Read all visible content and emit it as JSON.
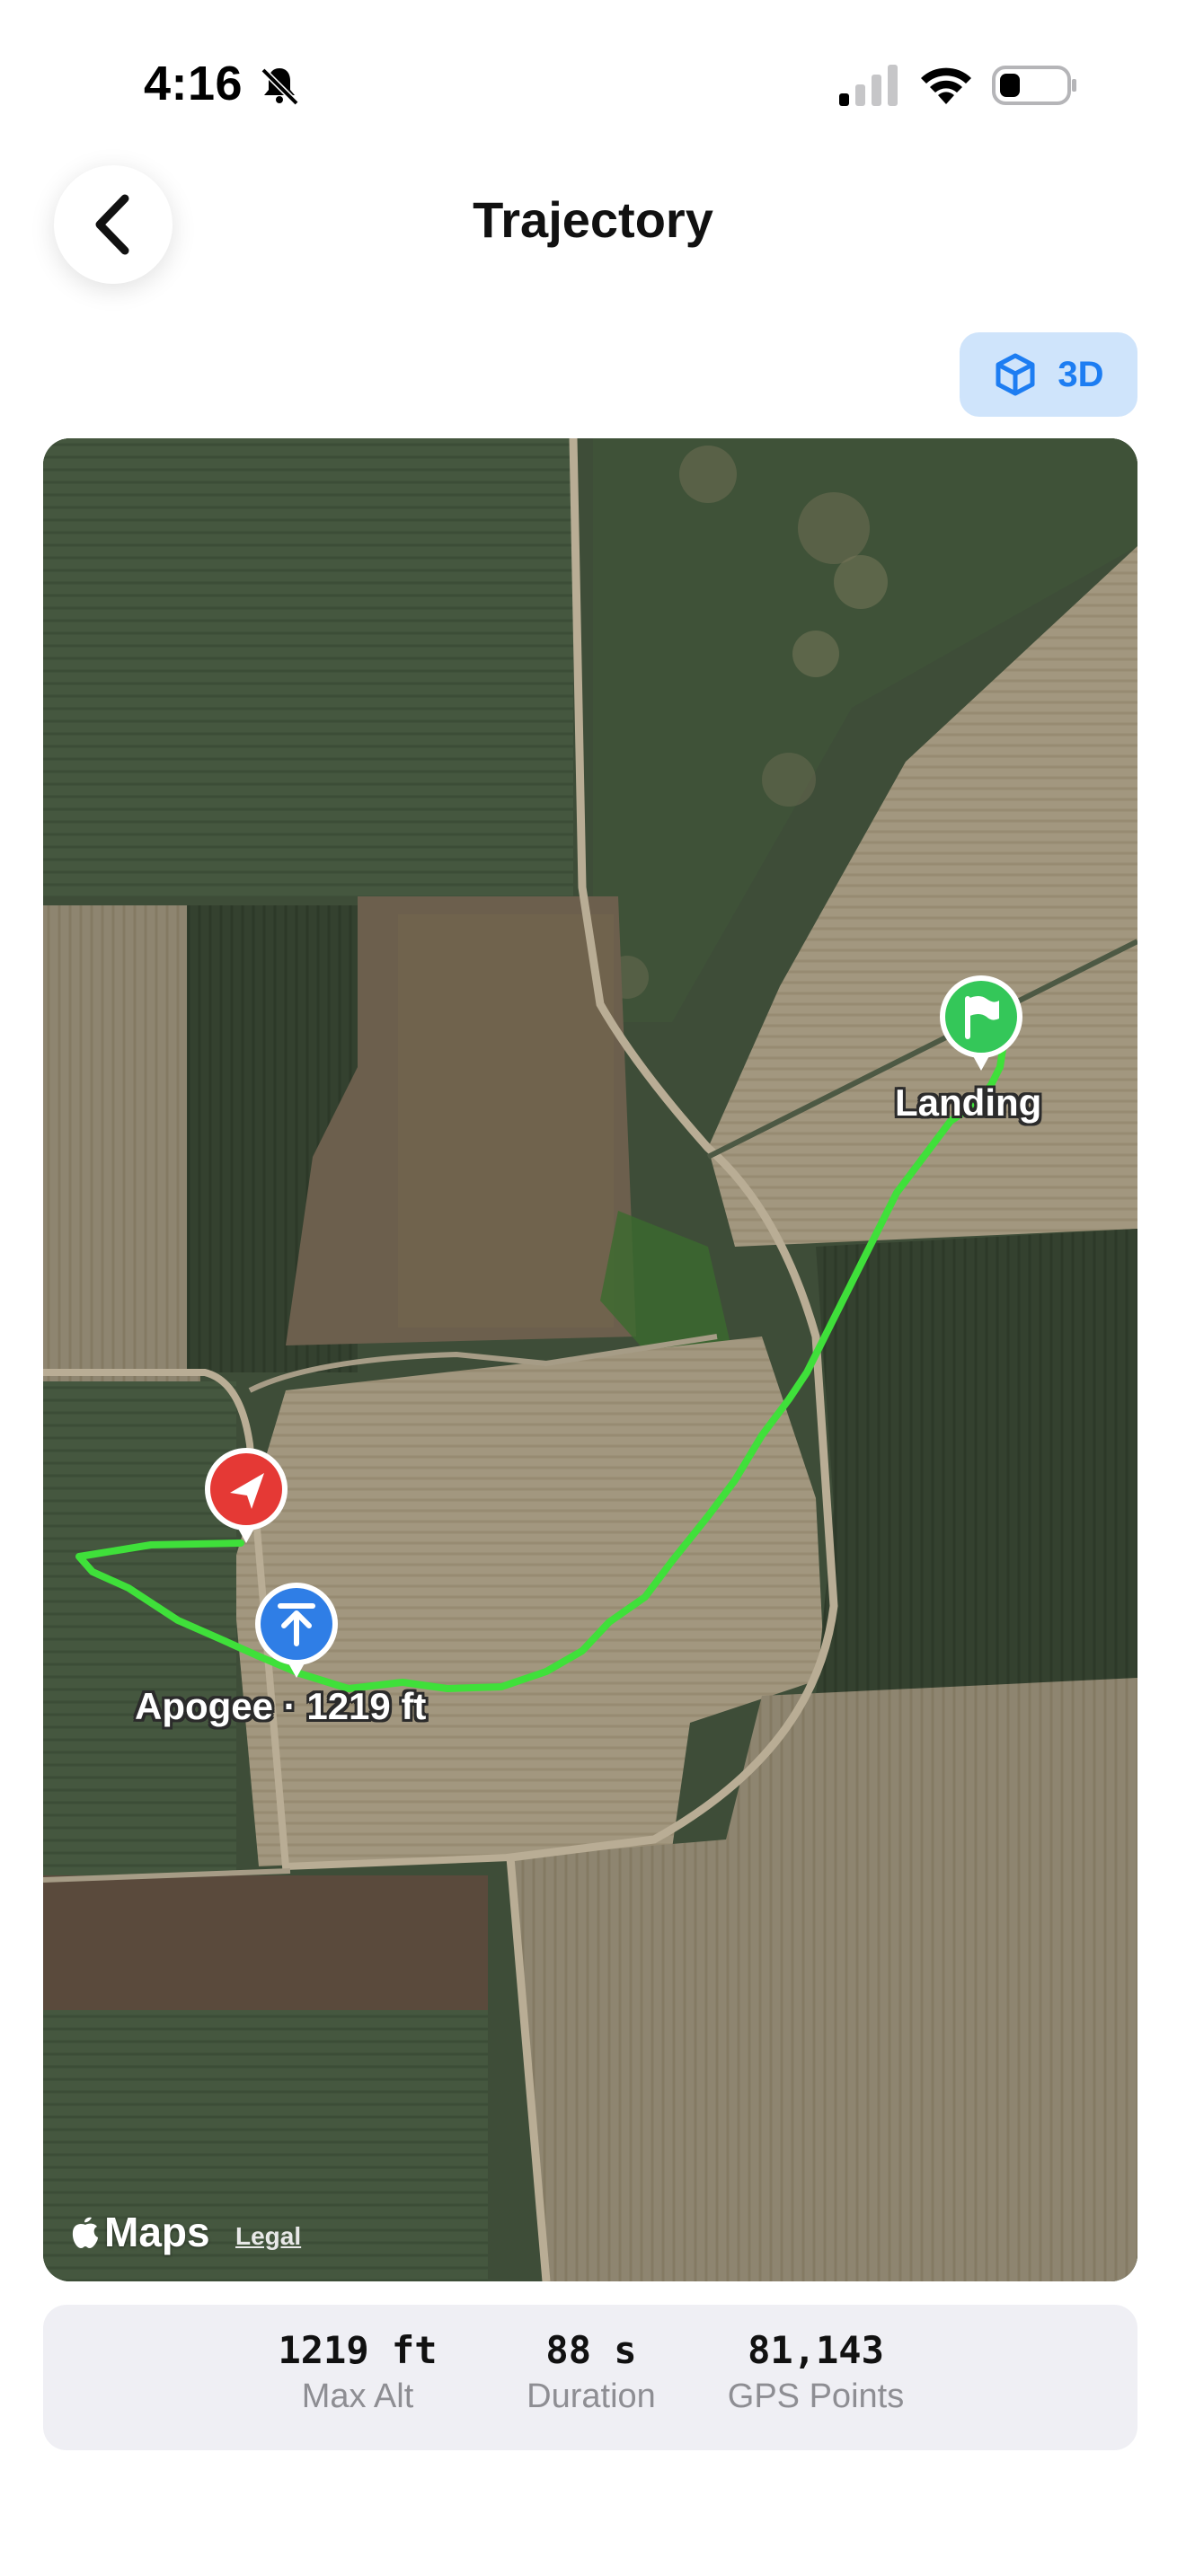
{
  "status_bar": {
    "time": "4:16"
  },
  "header": {
    "title": "Trajectory",
    "view_toggle_label": "3D"
  },
  "map": {
    "provider_label": "Maps",
    "legal_label": "Legal",
    "markers": {
      "landing_label": "Landing",
      "apogee_label": "Apogee · 1219 ft"
    },
    "colors": {
      "trajectory": "#3fe03a",
      "launch_marker": "#e53935",
      "apogee_marker": "#2f7ee6",
      "landing_marker": "#34c759"
    }
  },
  "stats": [
    {
      "value": "1219 ft",
      "label": "Max Alt"
    },
    {
      "value": "88 s",
      "label": "Duration"
    },
    {
      "value": "81,143",
      "label": "GPS Points"
    }
  ],
  "colors": {
    "accent": "#1d7df2",
    "toggle_bg": "#cfe4fb",
    "card_bg": "#efeff4"
  }
}
